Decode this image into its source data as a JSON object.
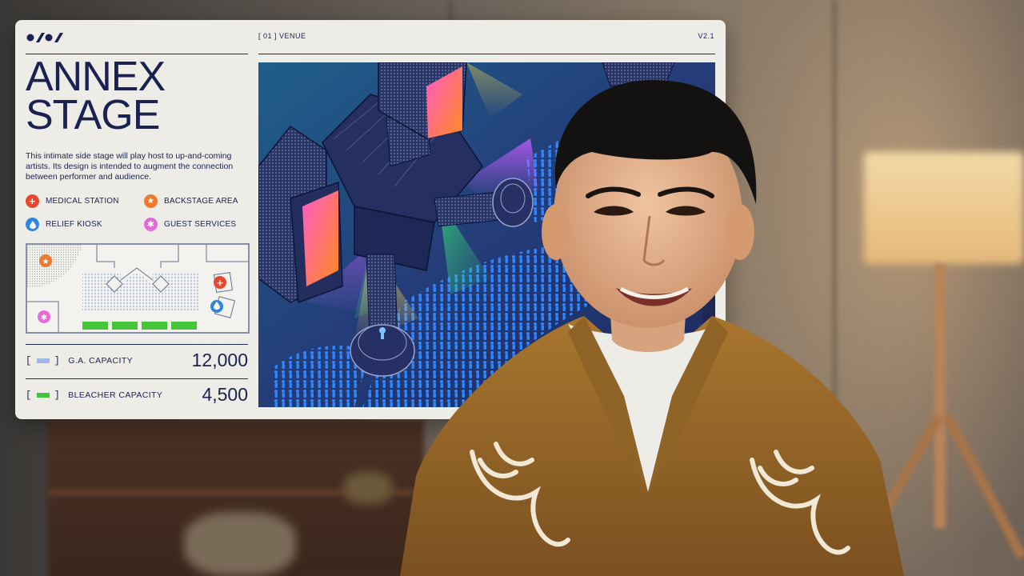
{
  "slide": {
    "section_label": "[ 01 ] VENUE",
    "version": "V2.1",
    "title_line1": "ANNEX",
    "title_line2": "STAGE",
    "description": "This intimate side stage will play host to up-and-coming artists. Its design is intended to augment the connection between performer and audience.",
    "legend": [
      {
        "label": "MEDICAL STATION",
        "icon": "medical-cross-icon",
        "color": "#e8472f",
        "glyph": "+"
      },
      {
        "label": "BACKSTAGE AREA",
        "icon": "star-icon",
        "color": "#ee7a2e",
        "glyph": "★"
      },
      {
        "label": "RELIEF KIOSK",
        "icon": "water-drop-icon",
        "color": "#2f86e0",
        "glyph": "●"
      },
      {
        "label": "GUEST SERVICES",
        "icon": "asterisk-icon",
        "color": "#e56ad8",
        "glyph": "✱"
      }
    ],
    "capacities": [
      {
        "label": "G.A. CAPACITY",
        "value": "12,000",
        "swatch_color": "#9fb6e6"
      },
      {
        "label": "BLEACHER CAPACITY",
        "value": "4,500",
        "swatch_color": "#3fc43a"
      }
    ],
    "colors": {
      "navy": "#1b2153",
      "card_bg": "#eeece6",
      "illustration_bg": "#2a3f7a",
      "crowd_blue": "#2e86ff",
      "bleacher_green": "#46c43a"
    }
  }
}
